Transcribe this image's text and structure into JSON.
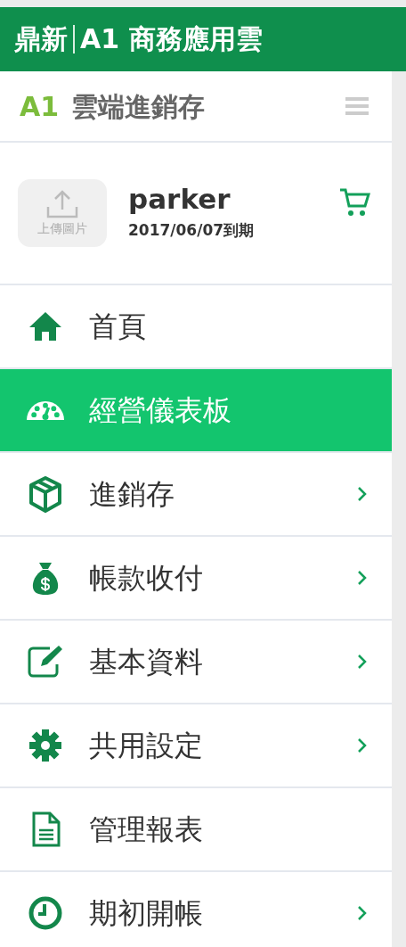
{
  "header": {
    "brand": "鼎新",
    "title": "A1 商務應用雲"
  },
  "logo": {
    "mark": "A1",
    "name": "雲端進銷存"
  },
  "profile": {
    "upload_label": "上傳圖片",
    "username": "parker",
    "expiry": "2017/06/07到期"
  },
  "menu": [
    {
      "label": "首頁",
      "kind": "home",
      "has_submenu": false,
      "selected": false
    },
    {
      "label": "經營儀表板",
      "kind": "dashboard",
      "has_submenu": false,
      "selected": true
    },
    {
      "label": "進銷存",
      "kind": "box",
      "has_submenu": true,
      "selected": false
    },
    {
      "label": "帳款收付",
      "kind": "moneybag",
      "has_submenu": true,
      "selected": false
    },
    {
      "label": "基本資料",
      "kind": "edit",
      "has_submenu": true,
      "selected": false
    },
    {
      "label": "共用設定",
      "kind": "gear",
      "has_submenu": true,
      "selected": false
    },
    {
      "label": "管理報表",
      "kind": "document",
      "has_submenu": false,
      "selected": false
    },
    {
      "label": "期初開帳",
      "kind": "clock",
      "has_submenu": true,
      "selected": false
    }
  ]
}
